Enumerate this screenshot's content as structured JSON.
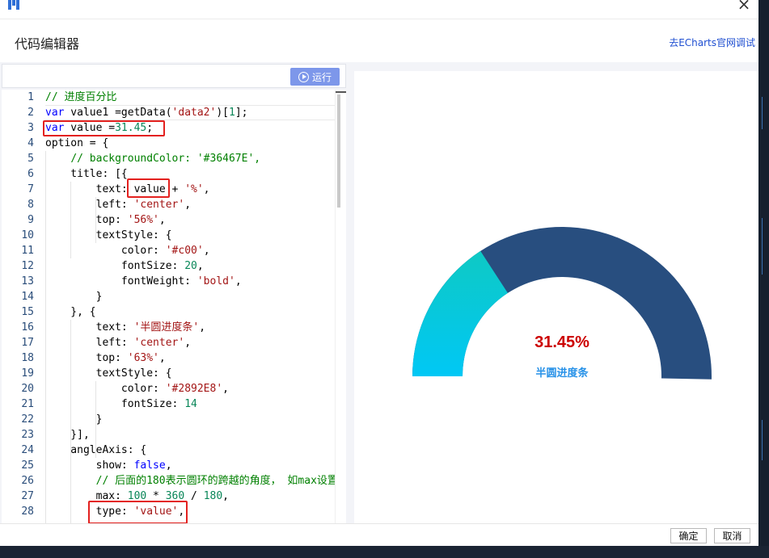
{
  "window": {
    "title": "代码编辑器",
    "echarts_link": "去ECharts官网调试"
  },
  "toolbar": {
    "run_label": "运行"
  },
  "editor": {
    "lines": [
      [
        [
          "t-comment",
          "// 进度百分比"
        ]
      ],
      [
        [
          "t-kw",
          "var"
        ],
        [
          "",
          " value1 =getData("
        ],
        [
          "t-str",
          "'data2'"
        ],
        [
          "",
          ")["
        ],
        [
          "t-num",
          "1"
        ],
        [
          "",
          "];"
        ]
      ],
      [
        [
          "t-kw",
          "var"
        ],
        [
          "",
          " value ="
        ],
        [
          "t-num",
          "31.45"
        ],
        [
          "",
          ";"
        ]
      ],
      [
        [
          "",
          "option = {"
        ]
      ],
      [
        [
          "",
          "    "
        ],
        [
          "t-comment",
          "// backgroundColor: '#36467E',"
        ]
      ],
      [
        [
          "",
          "    title: [{"
        ]
      ],
      [
        [
          "",
          "        text: value + "
        ],
        [
          "t-str",
          "'%'"
        ],
        [
          "",
          ","
        ]
      ],
      [
        [
          "",
          "        left: "
        ],
        [
          "t-str",
          "'center'"
        ],
        [
          "",
          ","
        ]
      ],
      [
        [
          "",
          "        top: "
        ],
        [
          "t-str",
          "'56%'"
        ],
        [
          "",
          ","
        ]
      ],
      [
        [
          "",
          "        textStyle: {"
        ]
      ],
      [
        [
          "",
          "            color: "
        ],
        [
          "t-str",
          "'#c00'"
        ],
        [
          "",
          ","
        ]
      ],
      [
        [
          "",
          "            fontSize: "
        ],
        [
          "t-num",
          "20"
        ],
        [
          "",
          ","
        ]
      ],
      [
        [
          "",
          "            fontWeight: "
        ],
        [
          "t-str",
          "'bold'"
        ],
        [
          "",
          ","
        ]
      ],
      [
        [
          "",
          "        }"
        ]
      ],
      [
        [
          "",
          "    }, {"
        ]
      ],
      [
        [
          "",
          "        text: "
        ],
        [
          "t-str",
          "'半圆进度条'"
        ],
        [
          "",
          ","
        ]
      ],
      [
        [
          "",
          "        left: "
        ],
        [
          "t-str",
          "'center'"
        ],
        [
          "",
          ","
        ]
      ],
      [
        [
          "",
          "        top: "
        ],
        [
          "t-str",
          "'63%'"
        ],
        [
          "",
          ","
        ]
      ],
      [
        [
          "",
          "        textStyle: {"
        ]
      ],
      [
        [
          "",
          "            color: "
        ],
        [
          "t-str",
          "'#2892E8'"
        ],
        [
          "",
          ","
        ]
      ],
      [
        [
          "",
          "            fontSize: "
        ],
        [
          "t-num",
          "14"
        ]
      ],
      [
        [
          "",
          "        }"
        ]
      ],
      [
        [
          "",
          "    }],"
        ]
      ],
      [
        [
          "",
          "    angleAxis: {"
        ]
      ],
      [
        [
          "",
          "        show: "
        ],
        [
          "t-kw",
          "false"
        ],
        [
          "",
          ","
        ]
      ],
      [
        [
          "",
          "        "
        ],
        [
          "t-comment",
          "// 后面的180表示圆环的跨越的角度， 如max设置"
        ]
      ],
      [
        [
          "",
          "        max: "
        ],
        [
          "t-num",
          "100"
        ],
        [
          "",
          " * "
        ],
        [
          "t-num",
          "360"
        ],
        [
          "",
          " / "
        ],
        [
          "t-num",
          "180"
        ],
        [
          "",
          ","
        ]
      ],
      [
        [
          "",
          "        type: "
        ],
        [
          "t-str",
          "'value'"
        ],
        [
          "",
          ","
        ]
      ]
    ]
  },
  "preview": {
    "value": 31.45,
    "max": 100,
    "value_text": "31.45%",
    "subtitle": "半圆进度条",
    "value_color": "#cc0000",
    "subtitle_color": "#2892E8",
    "track_color": "#284e7f",
    "gradient_start": "#0ec9c4",
    "gradient_end": "#00c8f5",
    "panel_bg": "#f3f4f8"
  },
  "footer": {
    "ok_label": "确定",
    "cancel_label": "取消"
  }
}
